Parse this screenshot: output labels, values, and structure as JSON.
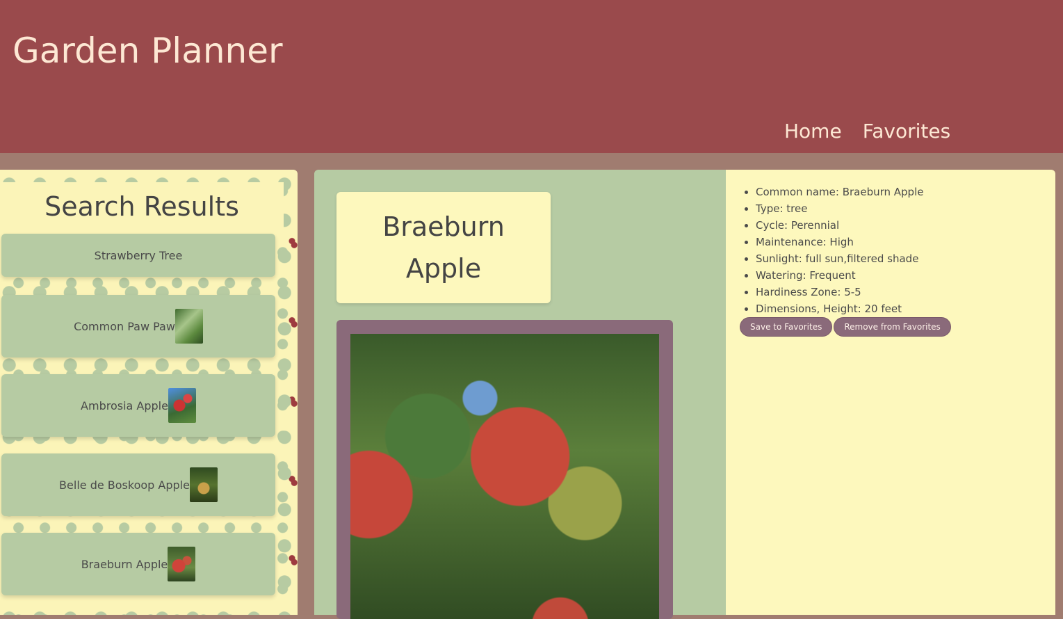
{
  "header": {
    "title": "Garden Planner",
    "nav": [
      "Home",
      "Favorites"
    ]
  },
  "sidebar": {
    "heading": "Search Results",
    "results": [
      {
        "label": "Strawberry Tree",
        "has_thumbnail": false
      },
      {
        "label": "Common Paw Paw",
        "has_thumbnail": true
      },
      {
        "label": "Ambrosia Apple",
        "has_thumbnail": true
      },
      {
        "label": "Belle de Boskoop Apple",
        "has_thumbnail": true
      },
      {
        "label": "Braeburn Apple",
        "has_thumbnail": true
      }
    ]
  },
  "main": {
    "plant_name_line1": "Braeburn",
    "plant_name_line2": "Apple"
  },
  "details": {
    "items": [
      "Common name: Braeburn Apple",
      "Type: tree",
      "Cycle: Perennial",
      "Maintenance: High",
      "Sunlight: full sun,filtered shade",
      "Watering: Frequent",
      "Hardiness Zone: 5-5",
      "Dimensions, Height: 20 feet"
    ],
    "save_label": "Save to Favorites",
    "remove_label": "Remove from Favorites"
  },
  "colors": {
    "header_bg": "#9a4a4c",
    "header_text": "#fde8d4",
    "page_bg": "#a07c70",
    "card_green": "#b6cba3",
    "card_cream": "#fdf8bd",
    "button_mauve": "#8a6a7a"
  }
}
